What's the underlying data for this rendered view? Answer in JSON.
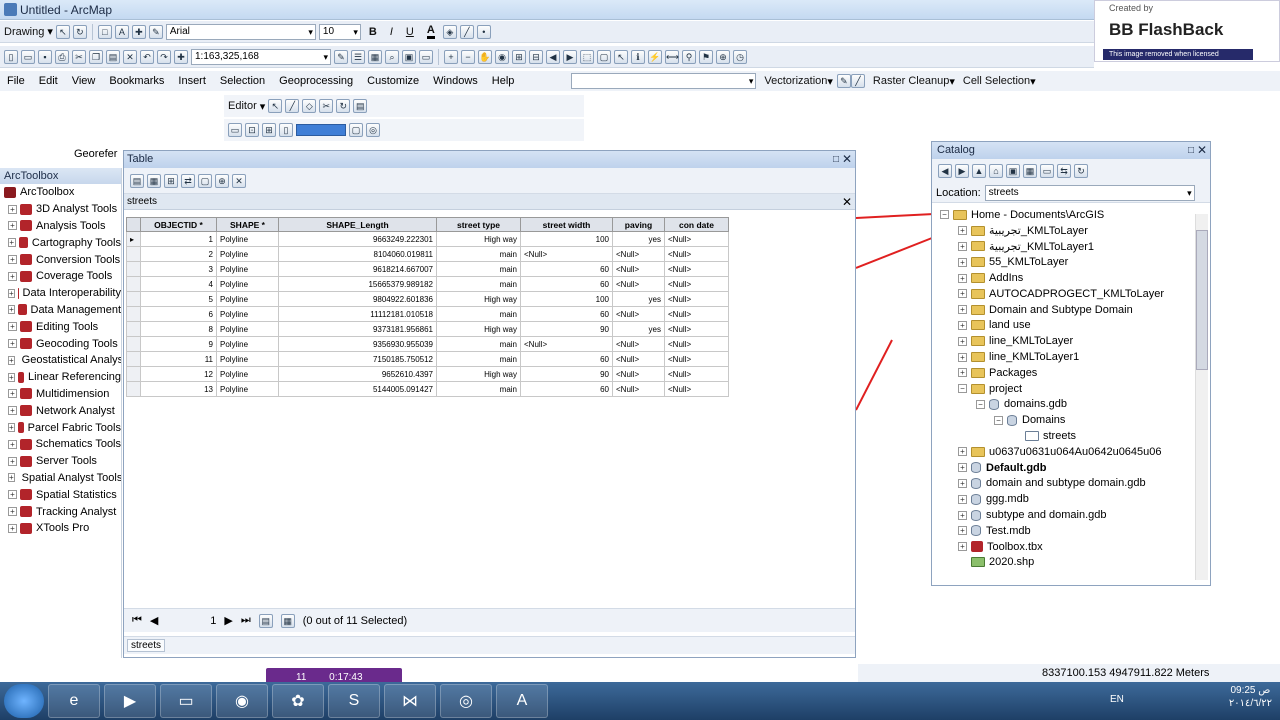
{
  "window": {
    "title": "Untitled - ArcMap"
  },
  "toolbar1": {
    "drawing": "Drawing",
    "font": "Arial",
    "size": "10",
    "bold": "B",
    "italic": "I",
    "underline": "U",
    "text_color": "A"
  },
  "toolbar2": {
    "scale": "1:163,325,168"
  },
  "menus": [
    "File",
    "Edit",
    "View",
    "Bookmarks",
    "Insert",
    "Selection",
    "Geoprocessing",
    "Customize",
    "Windows",
    "Help"
  ],
  "vectorization": "Vectorization",
  "raster_cleanup": "Raster Cleanup",
  "cell_selection": "Cell Selection",
  "editor": "Editor",
  "georef": "Georefer",
  "flashback": {
    "created": "Created by",
    "brand": "BB FlashBack",
    "note": "This image removed when licensed"
  },
  "arctoolbox": {
    "title": "ArcToolbox",
    "root": "ArcToolbox",
    "items": [
      "3D Analyst Tools",
      "Analysis Tools",
      "Cartography Tools",
      "Conversion Tools",
      "Coverage Tools",
      "Data Interoperability",
      "Data Management",
      "Editing Tools",
      "Geocoding Tools",
      "Geostatistical Analyst",
      "Linear Referencing",
      "Multidimension",
      "Network Analyst",
      "Parcel Fabric Tools",
      "Schematics Tools",
      "Server Tools",
      "Spatial Analyst Tools",
      "Spatial Statistics",
      "Tracking Analyst",
      "XTools Pro"
    ]
  },
  "table": {
    "title": "Table",
    "tab": "streets",
    "columns": [
      "OBJECTID *",
      "SHAPE *",
      "SHAPE_Length",
      "street type",
      "street width",
      "paving",
      "con date"
    ],
    "rows": [
      [
        "1",
        "Polyline",
        "9663249.222301",
        "High way",
        "100",
        "yes",
        "<Null>"
      ],
      [
        "2",
        "Polyline",
        "8104060.019811",
        "main",
        "<Null>",
        "<Null>",
        "<Null>"
      ],
      [
        "3",
        "Polyline",
        "9618214.667007",
        "main",
        "60",
        "<Null>",
        "<Null>"
      ],
      [
        "4",
        "Polyline",
        "15665379.989182",
        "main",
        "60",
        "<Null>",
        "<Null>"
      ],
      [
        "5",
        "Polyline",
        "9804922.601836",
        "High way",
        "100",
        "yes",
        "<Null>"
      ],
      [
        "6",
        "Polyline",
        "11112181.010518",
        "main",
        "60",
        "<Null>",
        "<Null>"
      ],
      [
        "8",
        "Polyline",
        "9373181.956861",
        "High way",
        "90",
        "yes",
        "<Null>"
      ],
      [
        "9",
        "Polyline",
        "9356930.955039",
        "main",
        "<Null>",
        "<Null>",
        "<Null>"
      ],
      [
        "11",
        "Polyline",
        "7150185.750512",
        "main",
        "60",
        "<Null>",
        "<Null>"
      ],
      [
        "12",
        "Polyline",
        "9652610.4397",
        "High way",
        "90",
        "<Null>",
        "<Null>"
      ],
      [
        "13",
        "Polyline",
        "5144005.091427",
        "main",
        "60",
        "<Null>",
        "<Null>"
      ]
    ],
    "page": "1",
    "selected": "(0 out of 11 Selected)",
    "bottom_tab": "streets"
  },
  "catalog": {
    "title": "Catalog",
    "location_label": "Location:",
    "location": "streets",
    "items": [
      "Home - Documents\\ArcGIS",
      "تجريبية_KMLToLayer",
      "تجريبية_KMLToLayer1",
      "55_KMLToLayer",
      "AddIns",
      "AUTOCADPROGECT_KMLToLayer",
      "Domain and Subtype Domain",
      "land use",
      "line_KMLToLayer",
      "line_KMLToLayer1",
      "Packages",
      "project",
      "domains.gdb",
      "Domains",
      "streets",
      "u0637u0631u064Au0642u0645u06",
      "Default.gdb",
      "domain and subtype domain.gdb",
      "ggg.mdb",
      "subtype and domain.gdb",
      "Test.mdb",
      "Toolbox.tbx",
      "2020.shp"
    ]
  },
  "status": {
    "coords": "8337100.153  4947911.822 Meters"
  },
  "recorder": {
    "time": "0:17:43",
    "count": "11"
  },
  "tray": {
    "lang": "EN",
    "time": "09:25 ص",
    "date": "٢٠١٤/٦/٢٢"
  }
}
